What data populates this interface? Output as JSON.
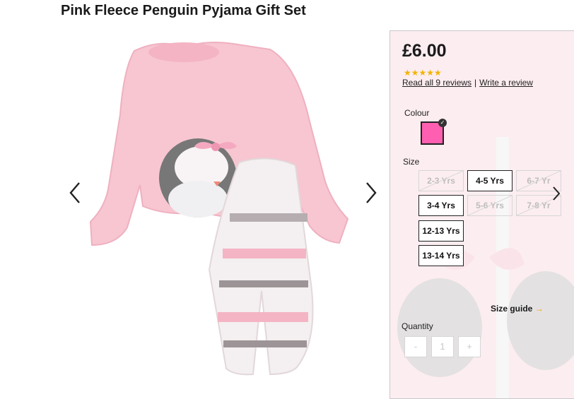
{
  "product": {
    "title": "Pink Fleece Penguin Pyjama Gift Set",
    "price": "£6.00",
    "rating_stars": "★★★★★",
    "reviews_link": "Read all 9 reviews",
    "separator": "|",
    "write_review": "Write a review"
  },
  "colour": {
    "label": "Colour",
    "swatch_color": "#ff5fb0",
    "check": "✓"
  },
  "size": {
    "label": "Size",
    "options": [
      {
        "label": "2-3 Yrs",
        "available": false
      },
      {
        "label": "4-5 Yrs",
        "available": true
      },
      {
        "label": "6-7 Yr",
        "available": false
      },
      {
        "label": "3-4 Yrs",
        "available": true
      },
      {
        "label": "5-6 Yrs",
        "available": false
      },
      {
        "label": "7-8 Yr",
        "available": false
      },
      {
        "label": "12-13 Yrs",
        "available": true
      },
      {
        "label": "13-14 Yrs",
        "available": true
      }
    ],
    "guide_label": "Size guide",
    "guide_arrow": "→"
  },
  "quantity": {
    "label": "Quantity",
    "minus": "-",
    "value": "1",
    "plus": "+"
  },
  "colors": {
    "product_pink": "#f7c6d1",
    "text": "#1a1a1a",
    "star": "#f2b400"
  }
}
